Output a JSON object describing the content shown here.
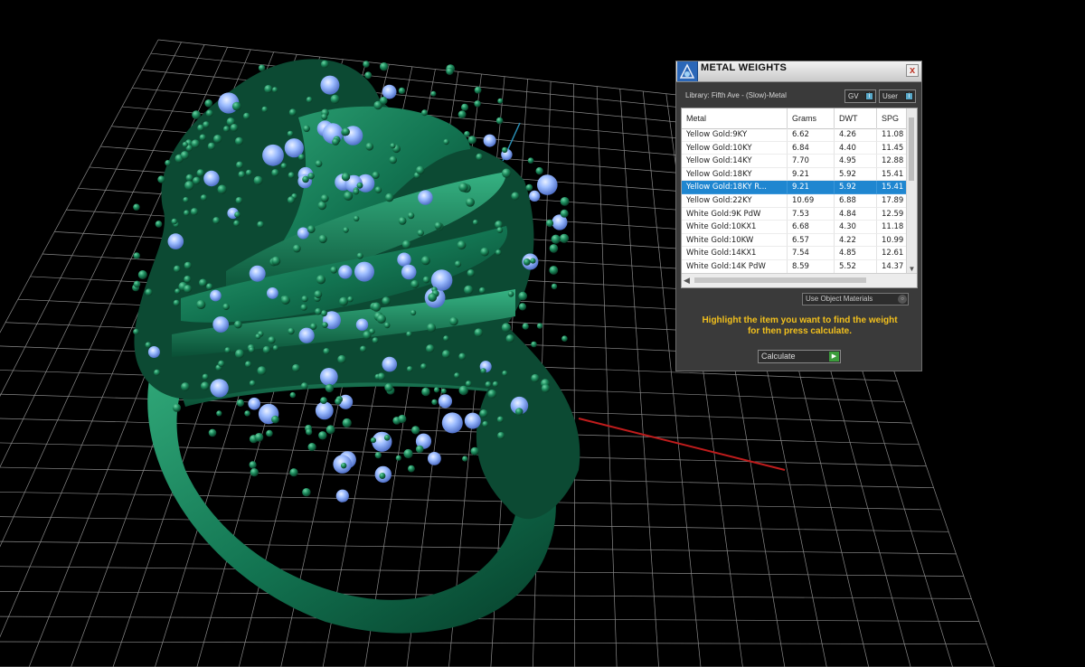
{
  "panel": {
    "title": "METAL WEIGHTS",
    "close_label": "x",
    "library_label": "Library: Fifth Ave - (Slow)-Metal",
    "btn_gv": "GV",
    "btn_user": "User",
    "columns": [
      "Metal",
      "Grams",
      "DWT",
      "SPG"
    ],
    "rows": [
      {
        "metal": "Yellow Gold:9KY",
        "grams": "6.62",
        "dwt": "4.26",
        "spg": "11.08"
      },
      {
        "metal": "Yellow Gold:10KY",
        "grams": "6.84",
        "dwt": "4.40",
        "spg": "11.45"
      },
      {
        "metal": "Yellow Gold:14KY",
        "grams": "7.70",
        "dwt": "4.95",
        "spg": "12.88"
      },
      {
        "metal": "Yellow Gold:18KY",
        "grams": "9.21",
        "dwt": "5.92",
        "spg": "15.41"
      },
      {
        "metal": "Yellow Gold:18KY R...",
        "grams": "9.21",
        "dwt": "5.92",
        "spg": "15.41"
      },
      {
        "metal": "Yellow Gold:22KY",
        "grams": "10.69",
        "dwt": "6.88",
        "spg": "17.89"
      },
      {
        "metal": "White Gold:9K PdW",
        "grams": "7.53",
        "dwt": "4.84",
        "spg": "12.59"
      },
      {
        "metal": "White Gold:10KX1",
        "grams": "6.68",
        "dwt": "4.30",
        "spg": "11.18"
      },
      {
        "metal": "White Gold:10KW",
        "grams": "6.57",
        "dwt": "4.22",
        "spg": "10.99"
      },
      {
        "metal": "White Gold:14KX1",
        "grams": "7.54",
        "dwt": "4.85",
        "spg": "12.61"
      },
      {
        "metal": "White Gold:14K PdW",
        "grams": "8.59",
        "dwt": "5.52",
        "spg": "14.37"
      }
    ],
    "selected_row": 4,
    "material_dropdown": "Use Object Materials",
    "hint_line1": "Highlight the item you want to find the weight",
    "hint_line2": "for then press calculate.",
    "calculate_label": "Calculate"
  },
  "colors": {
    "ring_green": "#1e7a55",
    "stone_blue": "#8fb4ff",
    "hint_yellow": "#f2c01d",
    "selection_blue": "#1f86d0"
  }
}
